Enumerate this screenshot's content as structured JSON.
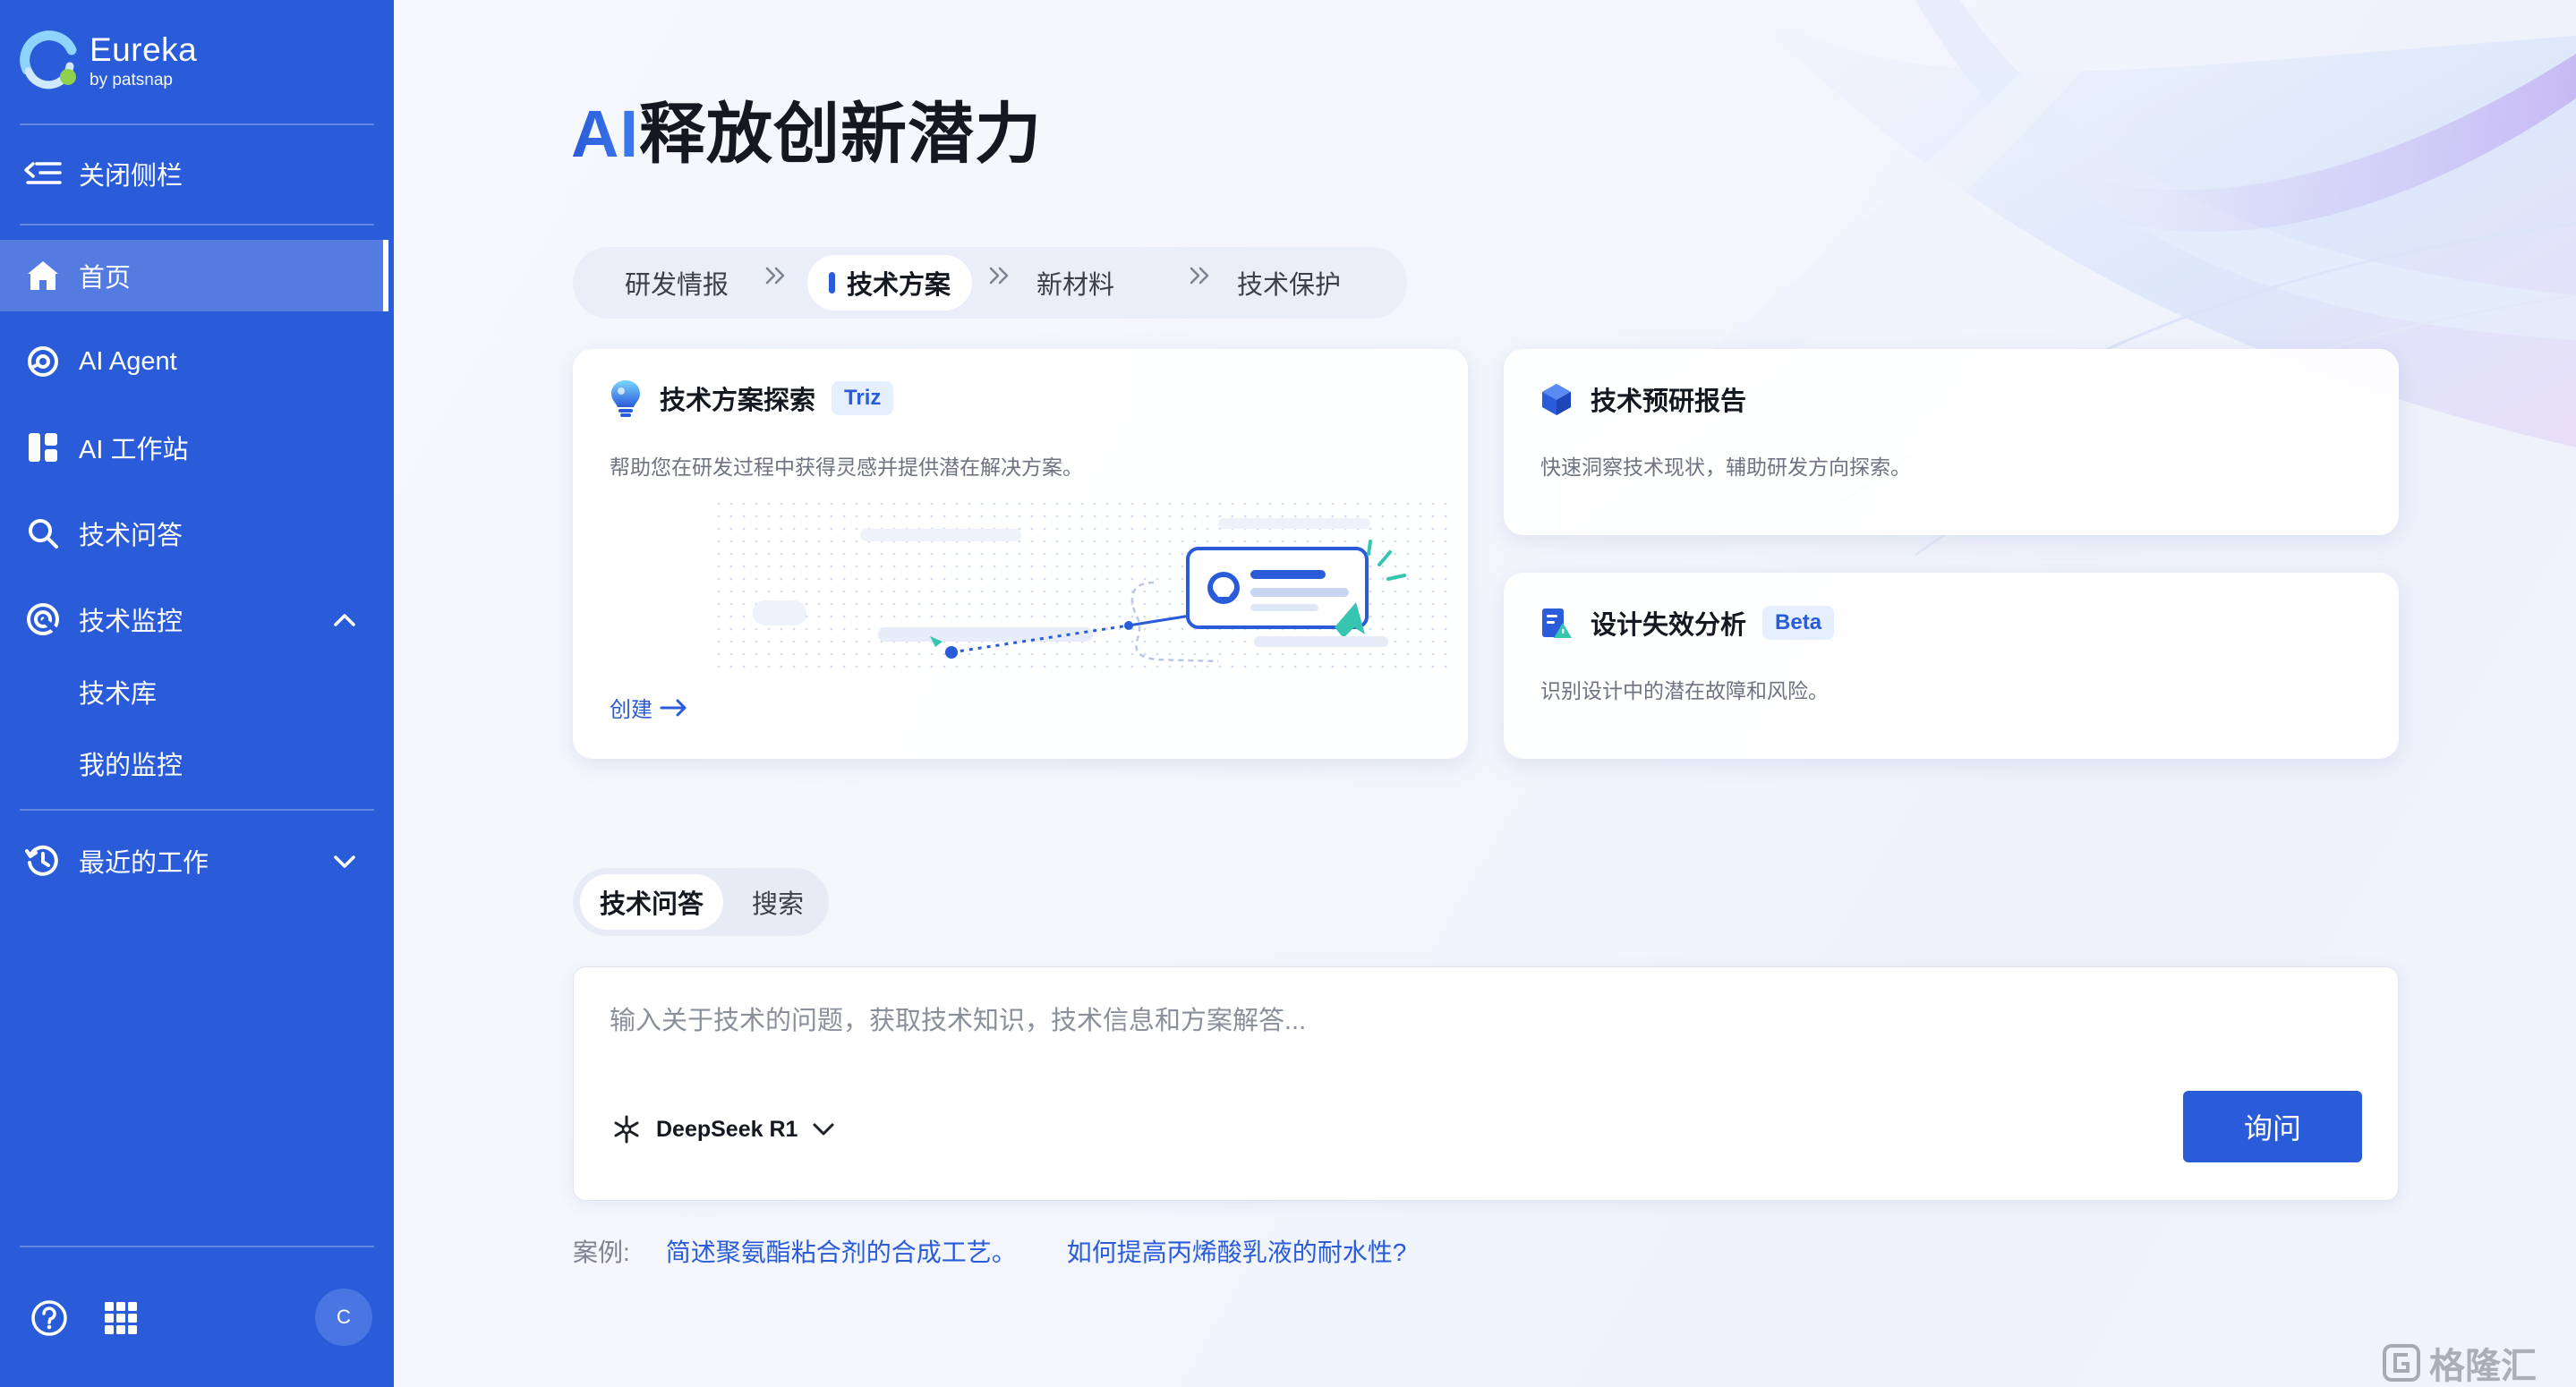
{
  "brand": {
    "name": "Eureka",
    "sub": "by patsnap",
    "accent": "#2a5bd8"
  },
  "sidebar": {
    "close_label": "关闭侧栏",
    "items": [
      {
        "label": "首页",
        "icon": "home-icon",
        "active": true
      },
      {
        "label": "AI Agent",
        "icon": "agent-icon"
      },
      {
        "label": "AI 工作站",
        "icon": "workstation-icon"
      },
      {
        "label": "技术问答",
        "icon": "search-icon"
      },
      {
        "label": "技术监控",
        "icon": "monitor-icon",
        "expanded": true,
        "children": [
          "技术库",
          "我的监控"
        ]
      },
      {
        "label": "最近的工作",
        "icon": "history-icon",
        "expanded": false
      }
    ],
    "avatar": "C"
  },
  "main": {
    "headline_ai": "AI",
    "headline_rest": "释放创新潜力",
    "steps": [
      "研发情报",
      "技术方案",
      "新材料",
      "技术保护"
    ],
    "active_step": 1,
    "cards": [
      {
        "title": "技术方案探索",
        "tag": "Triz",
        "desc": "帮助您在研发过程中获得灵感并提供潜在解决方案。",
        "action": "创建"
      },
      {
        "title": "技术预研报告",
        "desc": "快速洞察技术现状，辅助研发方向探索。"
      },
      {
        "title": "设计失效分析",
        "tag": "Beta",
        "desc": "识别设计中的潜在故障和风险。"
      }
    ],
    "query_tabs": [
      "技术问答",
      "搜索"
    ],
    "query": {
      "placeholder": "输入关于技术的问题，获取技术知识，技术信息和方案解答...",
      "value": "",
      "model": "DeepSeek R1",
      "submit": "询问"
    },
    "examples_label": "案例:",
    "examples": [
      "简述聚氨酯粘合剂的合成工艺。",
      "如何提高丙烯酸乳液的耐水性?"
    ]
  },
  "watermark": "格隆汇"
}
